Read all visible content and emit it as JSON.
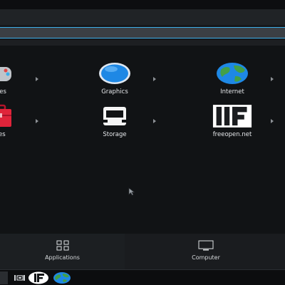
{
  "launcher": {
    "apps": [
      {
        "label": "mes",
        "icon": "games-icon"
      },
      {
        "label": "Graphics",
        "icon": "graphics-icon"
      },
      {
        "label": "Internet",
        "icon": "internet-globe-icon"
      },
      {
        "label": "ties",
        "icon": "utilities-toolbox-icon"
      },
      {
        "label": "Storage",
        "icon": "storage-drive-icon"
      },
      {
        "label": "freeopen.net",
        "icon": "freeopen-logo-icon"
      }
    ],
    "tabs": [
      {
        "label": "Applications",
        "icon": "applications-grid-icon",
        "active": true
      },
      {
        "label": "Computer",
        "icon": "computer-monitor-icon",
        "active": false
      }
    ]
  },
  "taskbar": {
    "items": [
      "launcher-tile",
      "task-manager-icon",
      "freeopen-logo-icon",
      "globe-browser-icon"
    ]
  },
  "colors": {
    "accent": "#3daee9",
    "panel_bg": "#111315",
    "toolbox_red": "#e0243a"
  }
}
